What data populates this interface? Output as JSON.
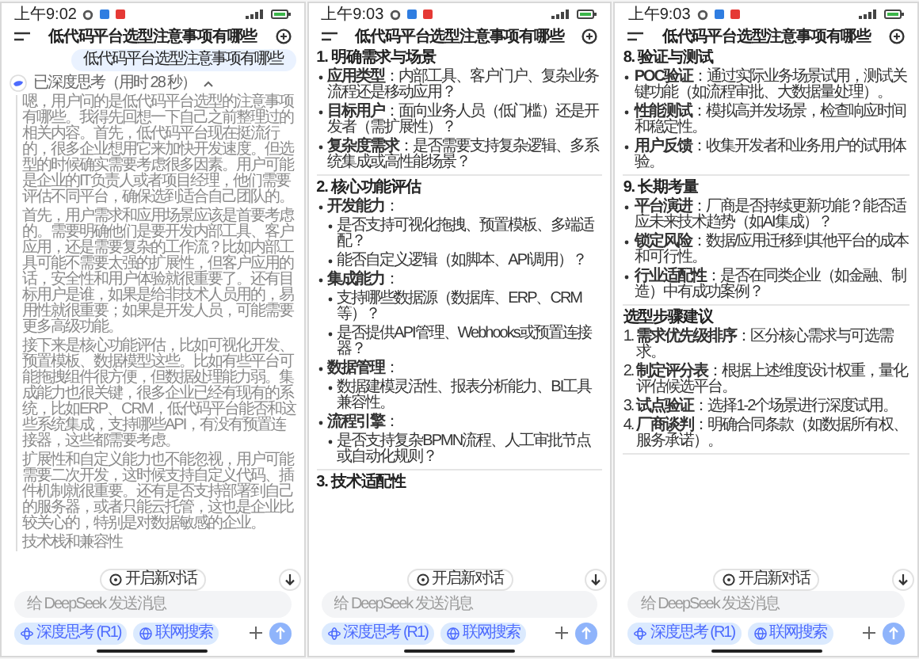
{
  "phones": [
    {
      "status_time": "上午9:02",
      "title": "低代码平台选型注意事项有哪些",
      "user_message": "低代码平台选型注意事项有哪些",
      "thinking": {
        "label": "已深度思考（用时 28 秒）",
        "expanded": true,
        "paragraphs": [
          "嗯，用户问的是低代码平台选型的注意事项有哪些。我得先回想一下自己之前整理过的相关内容。首先，低代码平台现在挺流行的，很多企业想用它来加快开发速度。但选型的时候确实需要考虑很多因素。用户可能是企业的IT负责人或者项目经理，他们需要评估不同平台，确保选到适合自己团队的。",
          "首先，用户需求和应用场景应该是首要考虑的。需要明确他们是要开发内部工具、客户应用，还是需要复杂的工作流？比如内部工具可能不需要太强的扩展性，但客户应用的话，安全性和用户体验就很重要了。还有目标用户是谁，如果是给非技术人员用的，易用性就很重要；如果是开发人员，可能需要更多高级功能。",
          "接下来是核心功能评估，比如可视化开发、预置模板、数据模型这些。比如有些平台可能拖拽组件很方便，但数据处理能力弱。集成能力也很关键，很多企业已经有现有的系统，比如ERP、CRM，低代码平台能否和这些系统集成，支持哪些API，有没有预置连接器，这些都需要考虑。",
          "扩展性和自定义能力也不能忽视，用户可能需要二次开发，这时候支持自定义代码、插件机制就很重要。还有是否支持部署到自己的服务器，或者只能云托管，这也是企业比较关心的，特别是对数据敏感的企业。",
          "技术栈和兼容性"
        ]
      },
      "new_chat_button": "开启新对话",
      "input": {
        "placeholder": "给 DeepSeek 发送消息"
      },
      "toggles": [
        {
          "label": "深度思考 (R1)",
          "selected": true
        },
        {
          "label": "联网搜索",
          "selected": true
        }
      ]
    },
    {
      "status_time": "上午9:03",
      "title": "低代码平台选型注意事项有哪些",
      "blocks": [
        {
          "kind": "heading",
          "text": "1. 明确需求与场景"
        },
        {
          "kind": "bullet",
          "text": "**应用类型**：内部工具、客户门户、复杂业务流程还是移动应用？"
        },
        {
          "kind": "bullet",
          "text": "**目标用户**：面向业务人员（低门槛）还是开发者（需扩展性）？"
        },
        {
          "kind": "bullet",
          "text": "**复杂度需求**：是否需要支持复杂逻辑、多系统集成或高性能场景？"
        },
        {
          "kind": "divider"
        },
        {
          "kind": "heading",
          "text": "2. 核心功能评估"
        },
        {
          "kind": "bullet",
          "text": "**开发能力**："
        },
        {
          "kind": "sub",
          "text": "是否支持可视化拖拽、预置模板、多端适配？"
        },
        {
          "kind": "sub",
          "text": "能否自定义逻辑（如脚本、API调用）？"
        },
        {
          "kind": "bullet",
          "text": "**集成能力**："
        },
        {
          "kind": "sub",
          "text": "支持哪些数据源（数据库、ERP、CRM等）？"
        },
        {
          "kind": "sub",
          "text": "是否提供API管理、Webhooks或预置连接器？"
        },
        {
          "kind": "bullet",
          "text": "**数据管理**："
        },
        {
          "kind": "sub",
          "text": "数据建模灵活性、报表分析能力、BI工具兼容性。"
        },
        {
          "kind": "bullet",
          "text": "**流程引擎**："
        },
        {
          "kind": "sub",
          "text": "是否支持复杂BPMN流程、人工审批节点或自动化规则？"
        },
        {
          "kind": "divider"
        },
        {
          "kind": "heading",
          "text": "3. 技术适配性"
        }
      ],
      "new_chat_button": "开启新对话",
      "input": {
        "placeholder": "给 DeepSeek 发送消息"
      },
      "toggles": [
        {
          "label": "深度思考 (R1)",
          "selected": true
        },
        {
          "label": "联网搜索",
          "selected": true
        }
      ]
    },
    {
      "status_time": "上午9:03",
      "title": "低代码平台选型注意事项有哪些",
      "blocks": [
        {
          "kind": "heading",
          "text": "8. 验证与测试"
        },
        {
          "kind": "bullet",
          "text": "**POC验证**：通过实际业务场景试用，测试关键功能（如流程审批、大数据量处理）。"
        },
        {
          "kind": "bullet",
          "text": "**性能测试**：模拟高并发场景，检查响应时间和稳定性。"
        },
        {
          "kind": "bullet",
          "text": "**用户反馈**：收集开发者和业务用户的试用体验。"
        },
        {
          "kind": "divider"
        },
        {
          "kind": "heading",
          "text": "9. 长期考量"
        },
        {
          "kind": "bullet",
          "text": "**平台演进**：厂商是否持续更新功能？能否适应未来技术趋势（如AI集成）？"
        },
        {
          "kind": "bullet",
          "text": "**锁定风险**：数据/应用迁移到其他平台的成本和可行性。"
        },
        {
          "kind": "bullet",
          "text": "**行业适配性**：是否在同类企业（如金融、制造）中有成功案例？"
        },
        {
          "kind": "divider"
        },
        {
          "kind": "heading",
          "text": "选型步骤建议"
        },
        {
          "kind": "numbered",
          "number": "1.",
          "text": "**需求优先级排序**：区分核心需求与可选需求。"
        },
        {
          "kind": "numbered",
          "number": "2.",
          "text": "**制定评分表**：根据上述维度设计权重，量化评估候选平台。"
        },
        {
          "kind": "numbered",
          "number": "3.",
          "text": "**试点验证**：选择1-2个场景进行深度试用。"
        },
        {
          "kind": "numbered",
          "number": "4.",
          "text": "**厂商谈判**：明确合同条款（如数据所有权、服务承诺）。"
        },
        {
          "kind": "divider"
        }
      ],
      "new_chat_button": "开启新对话",
      "input": {
        "placeholder": "给 DeepSeek 发送消息"
      },
      "toggles": [
        {
          "label": "深度思考 (R1)",
          "selected": true
        },
        {
          "label": "联网搜索",
          "selected": true
        }
      ]
    }
  ]
}
